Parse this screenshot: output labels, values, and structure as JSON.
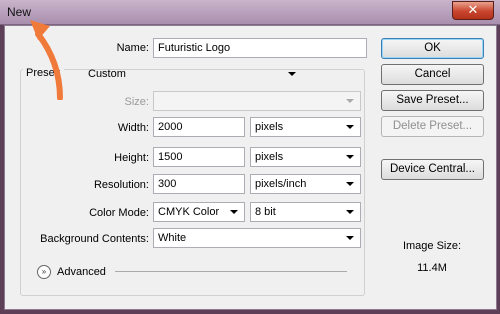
{
  "window": {
    "title": "New",
    "close_glyph": "✕"
  },
  "form": {
    "name_label": "Name:",
    "name_value": "Futuristic Logo",
    "preset_label": "Preset:",
    "preset_value": "Custom",
    "size_label": "Size:",
    "size_value": "",
    "width_label": "Width:",
    "width_value": "2000",
    "width_unit": "pixels",
    "height_label": "Height:",
    "height_value": "1500",
    "height_unit": "pixels",
    "resolution_label": "Resolution:",
    "resolution_value": "300",
    "resolution_unit": "pixels/inch",
    "color_mode_label": "Color Mode:",
    "color_mode_value": "CMYK Color",
    "bit_depth_value": "8 bit",
    "background_label": "Background Contents:",
    "background_value": "White",
    "advanced_label": "Advanced",
    "advanced_icon": "expand-chevrons-icon"
  },
  "buttons": {
    "ok": "OK",
    "cancel": "Cancel",
    "save_preset": "Save Preset...",
    "delete_preset": "Delete Preset...",
    "device_central": "Device Central..."
  },
  "image_size": {
    "label": "Image Size:",
    "value": "11.4M"
  },
  "colors": {
    "accent_arrow": "#f07a3a",
    "titlebar": "#b69cb9",
    "close_button": "#c8452e"
  }
}
